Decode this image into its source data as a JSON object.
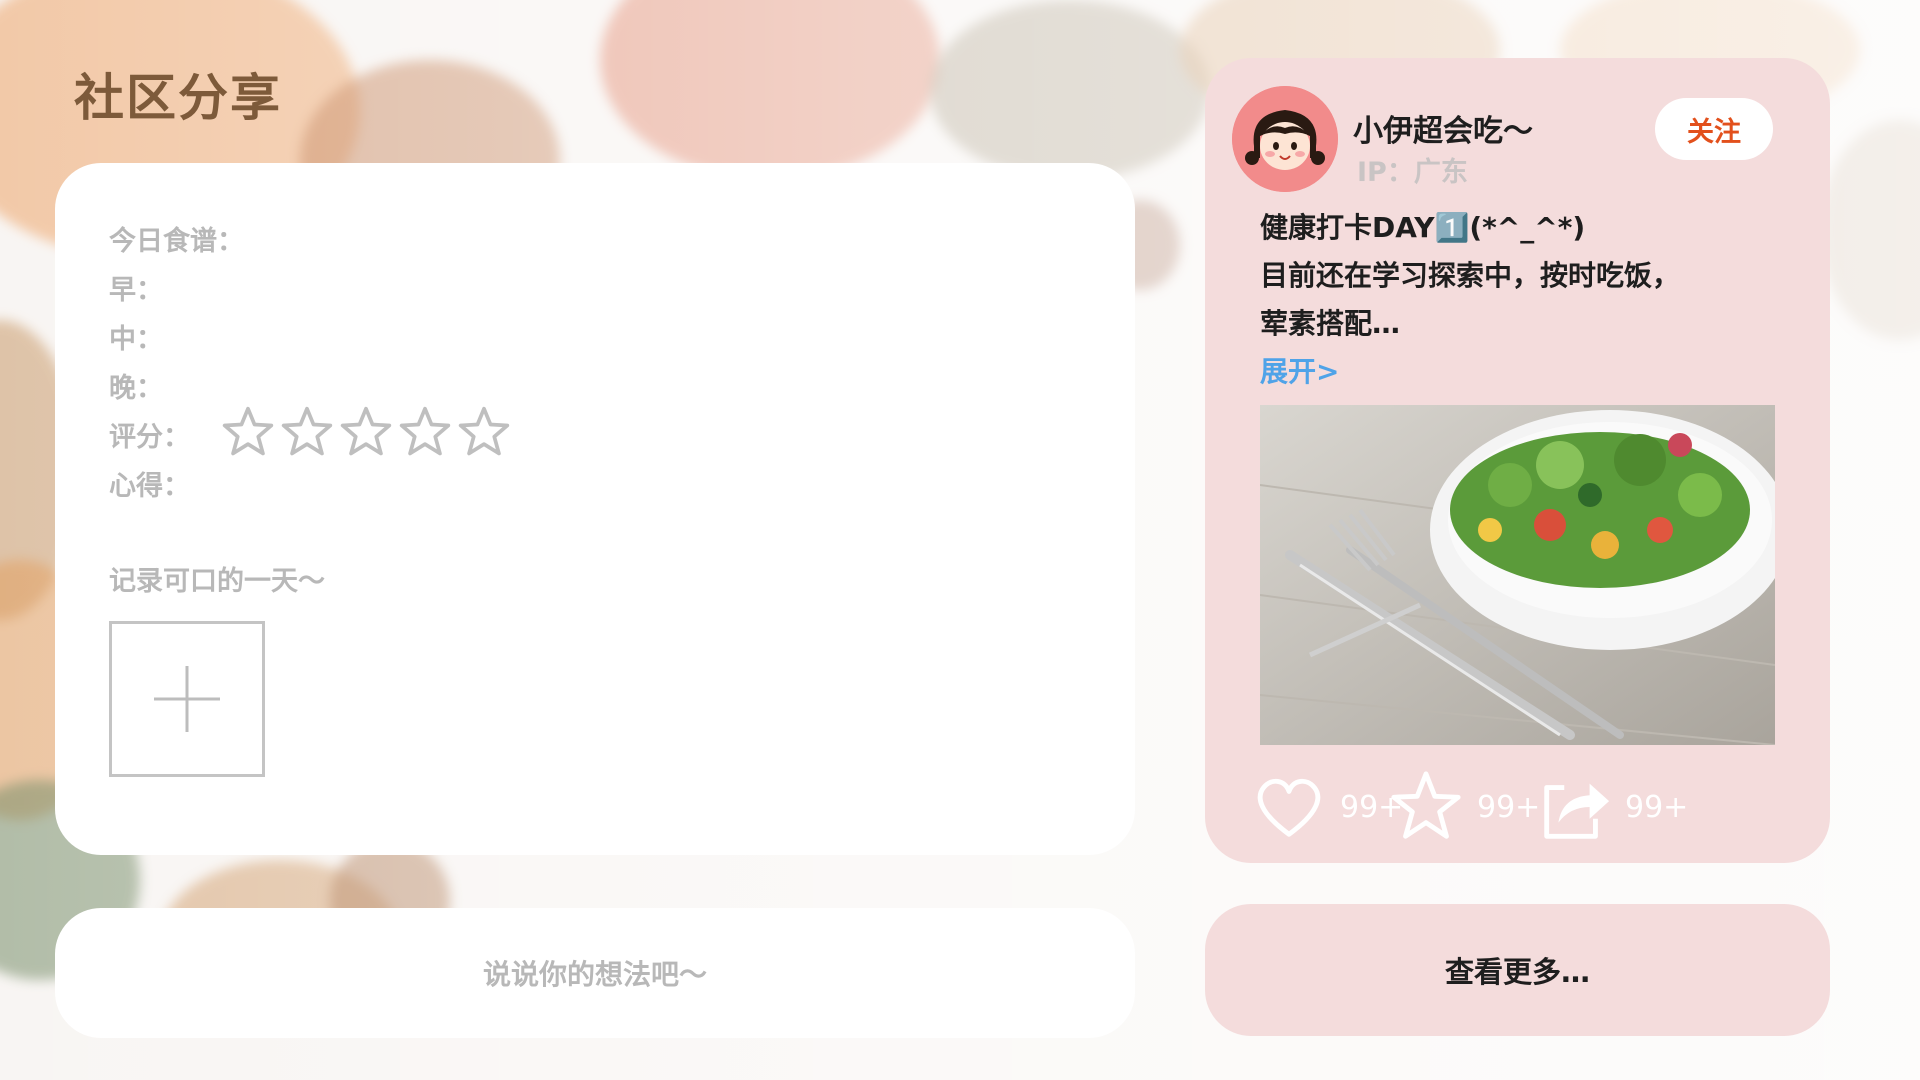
{
  "page": {
    "title": "社区分享"
  },
  "diary_form": {
    "today_menu_label": "今日食谱：",
    "breakfast_label": "早：",
    "lunch_label": "中：",
    "dinner_label": "晚：",
    "rating_label": "评分：",
    "rating_value": 0,
    "rating_max": 5,
    "notes_label": "心得：",
    "record_hint": "记录可口的一天～",
    "upload_icon": "plus-icon"
  },
  "comment_input": {
    "placeholder": "说说你的想法吧～"
  },
  "post": {
    "author": "小伊超会吃～",
    "ip": "IP：广东",
    "follow_label": "关注",
    "line1": "健康打卡DAY1️⃣(*^_^*)",
    "line2": "目前还在学习探索中，按时吃饭，",
    "line3": "荤素搭配…",
    "expand_label": "展开>",
    "image_subject": "salad-bowl",
    "likes": "99+",
    "favorites": "99+",
    "shares": "99+"
  },
  "view_more": {
    "label": "查看更多…"
  },
  "colors": {
    "title": "#7d5a3a",
    "card_pink": "#f4dcdc",
    "follow_text": "#e2501c",
    "link_blue": "#4fa3e8",
    "muted_gray": "#b8b8b8"
  }
}
